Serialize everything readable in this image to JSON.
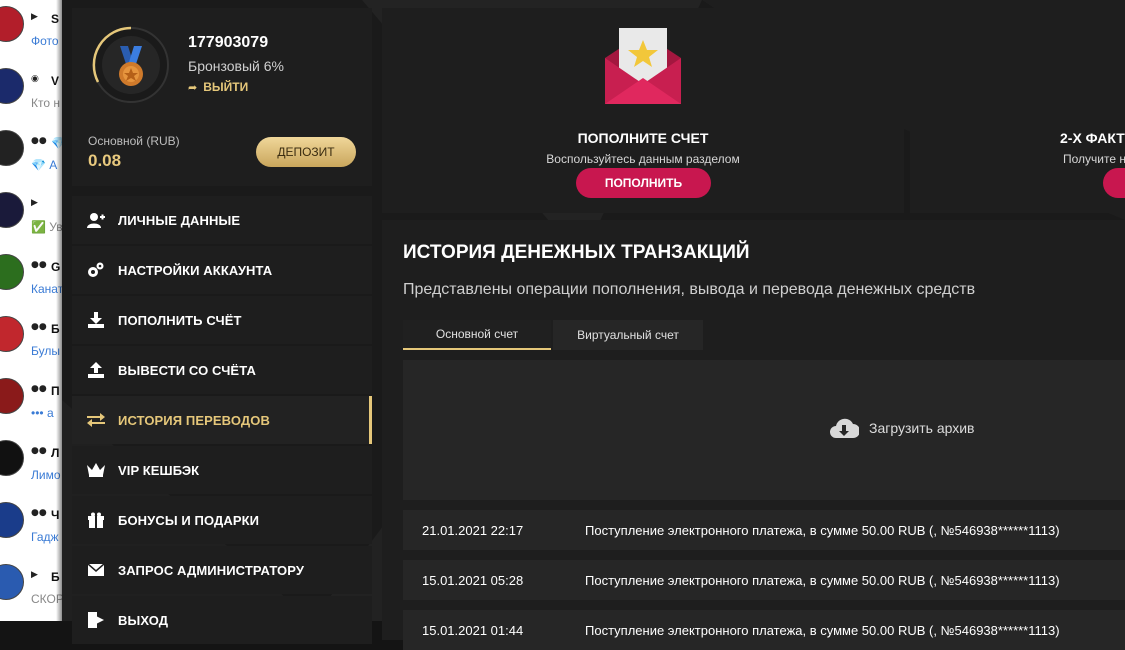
{
  "chat_list": [
    {
      "icon": "megaphone",
      "name": "S",
      "sub": "Фото",
      "sub_style": "link"
    },
    {
      "icon": "audio",
      "name": "V",
      "sub": "Кто н",
      "sub_style": "gray"
    },
    {
      "icon": "group",
      "name": "💎",
      "sub": "💎 А",
      "sub_style": "link"
    },
    {
      "icon": "megaphone",
      "name": "",
      "sub": "✅ Ув",
      "sub_style": "gray"
    },
    {
      "icon": "group",
      "name": "G",
      "sub": "Канат",
      "sub_style": "link"
    },
    {
      "icon": "group",
      "name": "Б",
      "sub": "Булы",
      "sub_style": "link"
    },
    {
      "icon": "group",
      "name": "П",
      "sub": "••• а",
      "sub_style": "link"
    },
    {
      "icon": "group",
      "name": "Л",
      "sub": "Лимо",
      "sub_style": "link"
    },
    {
      "icon": "group",
      "name": "Ч",
      "sub": "Гадж",
      "sub_style": "link"
    },
    {
      "icon": "megaphone",
      "name": "Б",
      "sub": "СКОР",
      "sub_style": "gray"
    }
  ],
  "profile": {
    "user_id": "177903079",
    "level": "Бронзовый 6%",
    "logout_label": "ВЫЙТИ",
    "balance_label": "Основной (RUB)",
    "balance_value": "0.08",
    "deposit_label": "ДЕПОЗИТ",
    "level_progress": 0.06
  },
  "menu": [
    {
      "label": "ЛИЧНЫЕ ДАННЫЕ",
      "icon": "user-plus-icon",
      "active": false
    },
    {
      "label": "НАСТРОЙКИ АККАУНТА",
      "icon": "gears-icon",
      "active": false
    },
    {
      "label": "ПОПОЛНИТЬ СЧЁТ",
      "icon": "download-icon",
      "active": false
    },
    {
      "label": "ВЫВЕСТИ СО СЧЁТА",
      "icon": "upload-icon",
      "active": false
    },
    {
      "label": "ИСТОРИЯ ПЕРЕВОДОВ",
      "icon": "exchange-icon",
      "active": true
    },
    {
      "label": "VIP КЕШБЭК",
      "icon": "crown-icon",
      "active": false
    },
    {
      "label": "БОНУСЫ И ПОДАРКИ",
      "icon": "gift-icon",
      "active": false
    },
    {
      "label": "ЗАПРОС АДМИНИСТРАТОРУ",
      "icon": "envelope-icon",
      "active": false
    },
    {
      "label": "ВЫХОД",
      "icon": "exit-icon",
      "active": false
    }
  ],
  "promo": {
    "deposit": {
      "title": "ПОПОЛНИТЕ СЧЕТ",
      "desc": "Воспользуйтесь данным разделом",
      "button": "ПОПОЛНИТЬ"
    },
    "twofa": {
      "title": "2-Х ФАКТ",
      "desc": "Получите н"
    }
  },
  "history": {
    "title": "ИСТОРИЯ ДЕНЕЖНЫХ ТРАНЗАКЦИЙ",
    "subtitle": "Представлены операции пополнения, вывода и перевода денежных средств",
    "tabs": [
      "Основной счет",
      "Виртуальный счет"
    ],
    "archive_label": "Загрузить архив",
    "rows": [
      {
        "date": "21.01.2021 22:17",
        "desc": "Поступление электронного платежа, в сумме 50.00 RUB (, №546938******1113)"
      },
      {
        "date": "15.01.2021 05:28",
        "desc": "Поступление электронного платежа, в сумме 50.00 RUB (, №546938******1113)"
      },
      {
        "date": "15.01.2021 01:44",
        "desc": "Поступление электронного платежа, в сумме 50.00 RUB (, №546938******1113)"
      }
    ]
  },
  "colors": {
    "accent_gold": "#e5c77a",
    "accent_red": "#c8174f",
    "panel": "#1e1e1e"
  }
}
